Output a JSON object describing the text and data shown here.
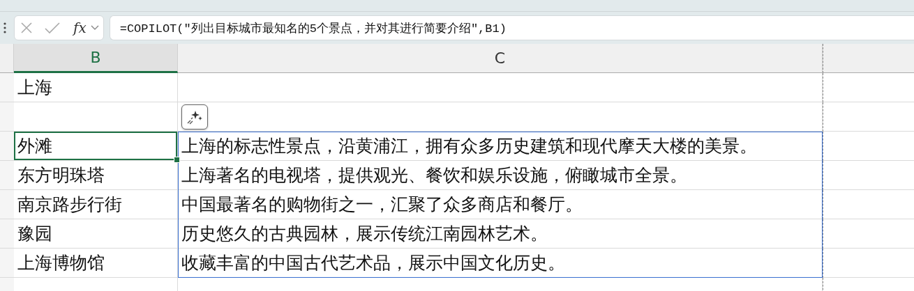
{
  "formula_bar": {
    "function_label": "fx",
    "formula": "=COPILOT(\"列出目标城市最知名的5个景点，并对其进行简要介绍\",B1)"
  },
  "columns": [
    {
      "label": "B",
      "selected": true
    },
    {
      "label": "C",
      "selected": false
    }
  ],
  "rows": [
    {
      "b": "上海",
      "selected": false,
      "spill": false
    },
    {
      "selected": false,
      "spill": false,
      "copilot_button": true
    },
    {
      "b": "外滩",
      "c": "上海的标志性景点，沿黄浦江，拥有众多历史建筑和现代摩天大楼的美景。",
      "selected": true,
      "spill": true
    },
    {
      "b": "东方明珠塔",
      "c": "上海著名的电视塔，提供观光、餐饮和娱乐设施，俯瞰城市全景。",
      "selected": false,
      "spill": true
    },
    {
      "b": "南京路步行街",
      "c": "中国最著名的购物街之一，汇聚了众多商店和餐厅。",
      "selected": false,
      "spill": true
    },
    {
      "b": "豫园",
      "c": "历史悠久的古典园林，展示传统江南园林艺术。",
      "selected": false,
      "spill": true
    },
    {
      "b": "上海博物馆",
      "c": "收藏丰富的中国古代艺术品，展示中国文化历史。",
      "selected": false,
      "spill": true
    },
    {
      "selected": false,
      "spill": false
    }
  ]
}
